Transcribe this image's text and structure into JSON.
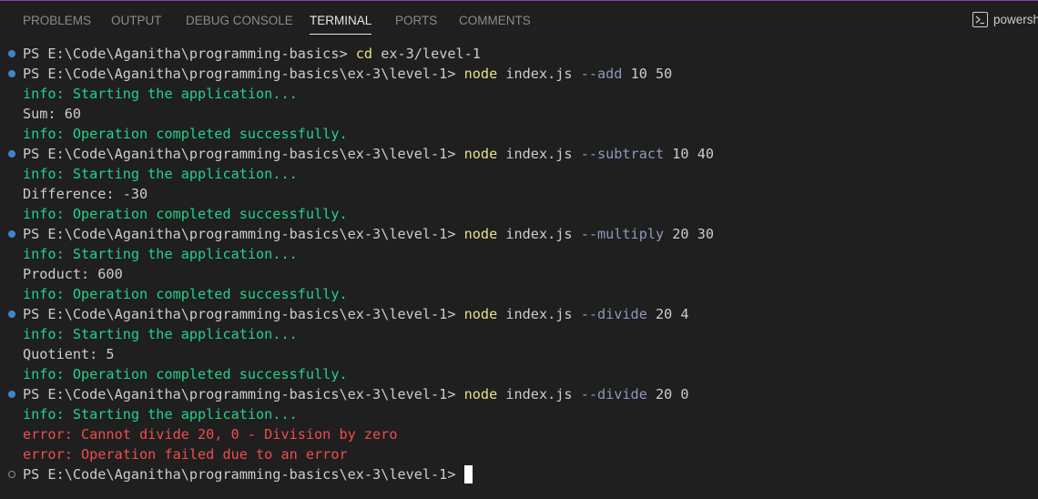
{
  "tabs": [
    {
      "label": "PROBLEMS",
      "active": false
    },
    {
      "label": "OUTPUT",
      "active": false
    },
    {
      "label": "DEBUG CONSOLE",
      "active": false
    },
    {
      "label": "TERMINAL",
      "active": true
    },
    {
      "label": "PORTS",
      "active": false
    },
    {
      "label": "COMMENTS",
      "active": false
    }
  ],
  "shell": {
    "icon": "terminal-powershell-icon",
    "label": "powersh"
  },
  "colors": {
    "background": "#1f1f1f",
    "info": "#23d18b",
    "error": "#f14c4c",
    "command": "#e6e089",
    "parameter": "#8c9ab8",
    "decoration_success": "#3f86c6"
  },
  "terminal": {
    "lines": [
      {
        "type": "command",
        "deco": "success",
        "prompt": "PS E:\\Code\\Aganitha\\programming-basics>",
        "cmd": "cd",
        "args": "ex-3/level-1",
        "param": ""
      },
      {
        "type": "command",
        "deco": "success",
        "prompt": "PS E:\\Code\\Aganitha\\programming-basics\\ex-3\\level-1>",
        "cmd": "node",
        "args": "index.js",
        "param": "--add",
        "values": "10 50"
      },
      {
        "type": "info",
        "text": "info: Starting the application..."
      },
      {
        "type": "output",
        "text": "Sum: 60"
      },
      {
        "type": "info",
        "text": "info: Operation completed successfully."
      },
      {
        "type": "command",
        "deco": "success",
        "prompt": "PS E:\\Code\\Aganitha\\programming-basics\\ex-3\\level-1>",
        "cmd": "node",
        "args": "index.js",
        "param": "--subtract",
        "values": "10 40"
      },
      {
        "type": "info",
        "text": "info: Starting the application..."
      },
      {
        "type": "output",
        "text": "Difference: -30"
      },
      {
        "type": "info",
        "text": "info: Operation completed successfully."
      },
      {
        "type": "command",
        "deco": "success",
        "prompt": "PS E:\\Code\\Aganitha\\programming-basics\\ex-3\\level-1>",
        "cmd": "node",
        "args": "index.js",
        "param": "--multiply",
        "values": "20 30"
      },
      {
        "type": "info",
        "text": "info: Starting the application..."
      },
      {
        "type": "output",
        "text": "Product: 600"
      },
      {
        "type": "info",
        "text": "info: Operation completed successfully."
      },
      {
        "type": "command",
        "deco": "success",
        "prompt": "PS E:\\Code\\Aganitha\\programming-basics\\ex-3\\level-1>",
        "cmd": "node",
        "args": "index.js",
        "param": "--divide",
        "values": "20 4"
      },
      {
        "type": "info",
        "text": "info: Starting the application..."
      },
      {
        "type": "output",
        "text": "Quotient: 5"
      },
      {
        "type": "info",
        "text": "info: Operation completed successfully."
      },
      {
        "type": "command",
        "deco": "success",
        "prompt": "PS E:\\Code\\Aganitha\\programming-basics\\ex-3\\level-1>",
        "cmd": "node",
        "args": "index.js",
        "param": "--divide",
        "values": "20 0"
      },
      {
        "type": "info",
        "text": "info: Starting the application..."
      },
      {
        "type": "error",
        "text": "error: Cannot divide 20, 0 - Division by zero"
      },
      {
        "type": "error",
        "text": "error: Operation failed due to an error"
      },
      {
        "type": "prompt",
        "deco": "empty",
        "prompt": "PS E:\\Code\\Aganitha\\programming-basics\\ex-3\\level-1>",
        "cursor": true
      }
    ]
  }
}
